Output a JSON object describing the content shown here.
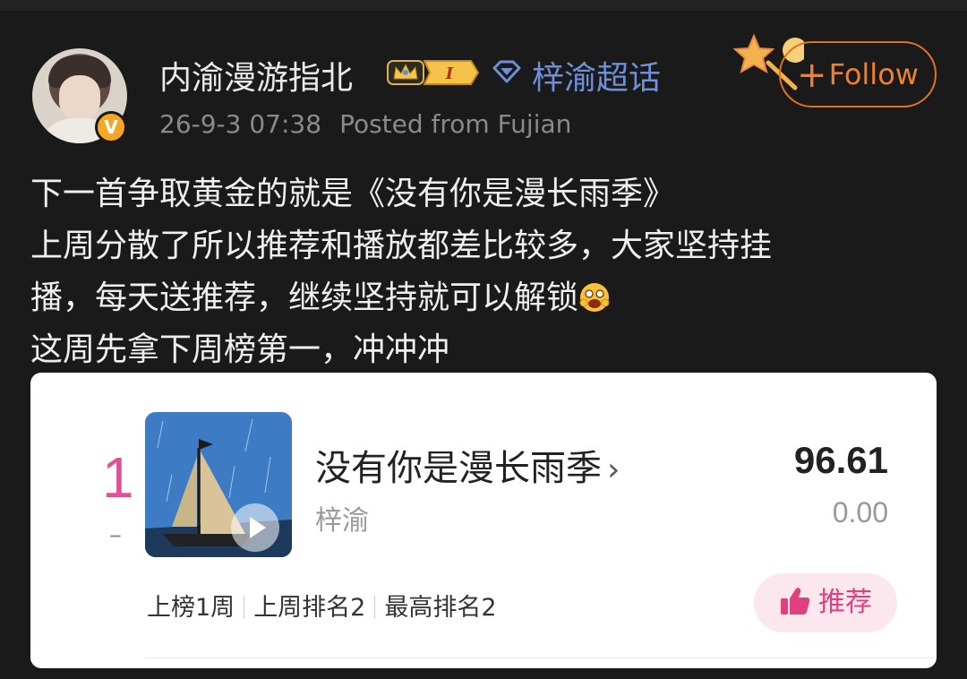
{
  "post": {
    "author": "内渝漫游指北",
    "level_badge": "I",
    "topic": "梓渝超话",
    "timestamp": "26-9-3 07:38",
    "source": "Posted from Fujian",
    "follow_label": "Follow",
    "text_lines": [
      "下一首争取黄金的就是《没有你是漫长雨季》",
      "上周分散了所以推荐和播放都差比较多，大家坚持挂",
      "播，每天送推荐，继续坚持就可以解锁",
      "这周先拿下周榜第一，冲冲冲"
    ]
  },
  "chart_card": {
    "rank": "1",
    "rank_change": "–",
    "song_title": "没有你是漫长雨季",
    "artist": "梓渝",
    "score": "96.61",
    "score_change": "0.00",
    "stats": {
      "weeks": "上榜1周",
      "last_week": "上周排名2",
      "peak": "最高排名2"
    },
    "recommend_label": "推荐"
  },
  "colors": {
    "accent_follow": "#f08030",
    "topic_link": "#6f8fd6",
    "rank_pink": "#e0509a",
    "recommend_bg": "#fde7ef"
  },
  "icons": {
    "verified": "verified-v-badge-icon",
    "crown": "crown-icon",
    "diamond": "diamond-icon",
    "star": "star-decoration-icon",
    "emoji": "grinning-emoji-icon",
    "play": "play-icon",
    "thumb": "thumbs-up-icon"
  }
}
